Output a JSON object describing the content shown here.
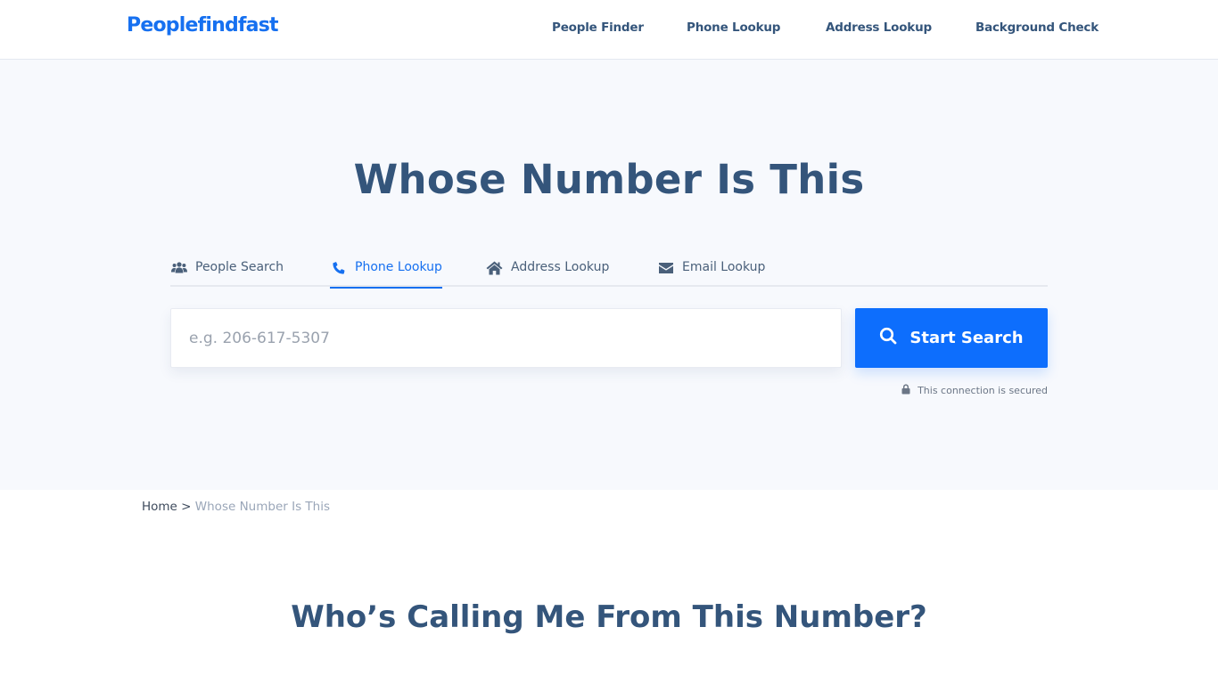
{
  "header": {
    "logo": "Peoplefindfast",
    "nav": [
      "People Finder",
      "Phone Lookup",
      "Address Lookup",
      "Background Check"
    ]
  },
  "hero": {
    "title": "Whose Number Is This",
    "tabs": [
      {
        "label": "People Search",
        "icon": "users-icon",
        "active": false
      },
      {
        "label": "Phone Lookup",
        "icon": "phone-icon",
        "active": true
      },
      {
        "label": "Address Lookup",
        "icon": "home-icon",
        "active": false
      },
      {
        "label": "Email Lookup",
        "icon": "envelope-icon",
        "active": false
      }
    ],
    "search": {
      "value": "",
      "placeholder": "e.g. 206-617-5307",
      "button_label": "Start Search",
      "button_icon": "search-icon"
    },
    "secure_text": "This connection is secured",
    "secure_icon": "lock-icon"
  },
  "breadcrumb": {
    "home": "Home",
    "separator": ">",
    "current": "Whose Number Is This"
  },
  "section": {
    "title": "Who’s Calling Me From This Number?"
  },
  "colors": {
    "brand": "#1670f0",
    "button": "#0d6efd",
    "heading": "#34557b",
    "hero_bg": "#f7f9fd"
  }
}
